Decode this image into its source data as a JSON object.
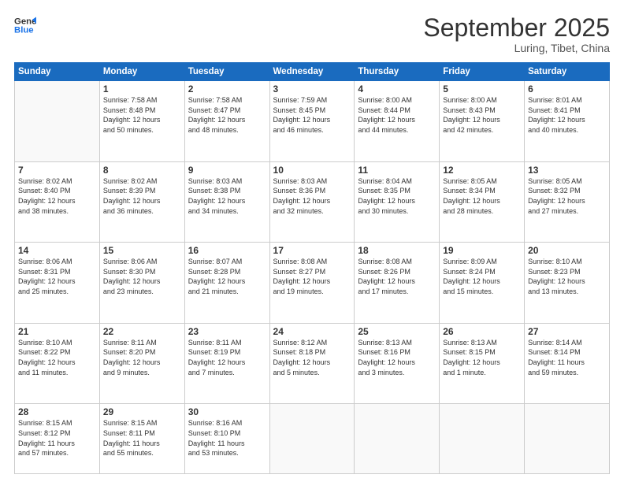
{
  "header": {
    "logo": {
      "line1": "General",
      "line2": "Blue"
    },
    "title": "September 2025",
    "location": "Luring, Tibet, China"
  },
  "weekdays": [
    "Sunday",
    "Monday",
    "Tuesday",
    "Wednesday",
    "Thursday",
    "Friday",
    "Saturday"
  ],
  "weeks": [
    [
      {
        "day": "",
        "text": ""
      },
      {
        "day": "1",
        "text": "Sunrise: 7:58 AM\nSunset: 8:48 PM\nDaylight: 12 hours\nand 50 minutes."
      },
      {
        "day": "2",
        "text": "Sunrise: 7:58 AM\nSunset: 8:47 PM\nDaylight: 12 hours\nand 48 minutes."
      },
      {
        "day": "3",
        "text": "Sunrise: 7:59 AM\nSunset: 8:45 PM\nDaylight: 12 hours\nand 46 minutes."
      },
      {
        "day": "4",
        "text": "Sunrise: 8:00 AM\nSunset: 8:44 PM\nDaylight: 12 hours\nand 44 minutes."
      },
      {
        "day": "5",
        "text": "Sunrise: 8:00 AM\nSunset: 8:43 PM\nDaylight: 12 hours\nand 42 minutes."
      },
      {
        "day": "6",
        "text": "Sunrise: 8:01 AM\nSunset: 8:41 PM\nDaylight: 12 hours\nand 40 minutes."
      }
    ],
    [
      {
        "day": "7",
        "text": "Sunrise: 8:02 AM\nSunset: 8:40 PM\nDaylight: 12 hours\nand 38 minutes."
      },
      {
        "day": "8",
        "text": "Sunrise: 8:02 AM\nSunset: 8:39 PM\nDaylight: 12 hours\nand 36 minutes."
      },
      {
        "day": "9",
        "text": "Sunrise: 8:03 AM\nSunset: 8:38 PM\nDaylight: 12 hours\nand 34 minutes."
      },
      {
        "day": "10",
        "text": "Sunrise: 8:03 AM\nSunset: 8:36 PM\nDaylight: 12 hours\nand 32 minutes."
      },
      {
        "day": "11",
        "text": "Sunrise: 8:04 AM\nSunset: 8:35 PM\nDaylight: 12 hours\nand 30 minutes."
      },
      {
        "day": "12",
        "text": "Sunrise: 8:05 AM\nSunset: 8:34 PM\nDaylight: 12 hours\nand 28 minutes."
      },
      {
        "day": "13",
        "text": "Sunrise: 8:05 AM\nSunset: 8:32 PM\nDaylight: 12 hours\nand 27 minutes."
      }
    ],
    [
      {
        "day": "14",
        "text": "Sunrise: 8:06 AM\nSunset: 8:31 PM\nDaylight: 12 hours\nand 25 minutes."
      },
      {
        "day": "15",
        "text": "Sunrise: 8:06 AM\nSunset: 8:30 PM\nDaylight: 12 hours\nand 23 minutes."
      },
      {
        "day": "16",
        "text": "Sunrise: 8:07 AM\nSunset: 8:28 PM\nDaylight: 12 hours\nand 21 minutes."
      },
      {
        "day": "17",
        "text": "Sunrise: 8:08 AM\nSunset: 8:27 PM\nDaylight: 12 hours\nand 19 minutes."
      },
      {
        "day": "18",
        "text": "Sunrise: 8:08 AM\nSunset: 8:26 PM\nDaylight: 12 hours\nand 17 minutes."
      },
      {
        "day": "19",
        "text": "Sunrise: 8:09 AM\nSunset: 8:24 PM\nDaylight: 12 hours\nand 15 minutes."
      },
      {
        "day": "20",
        "text": "Sunrise: 8:10 AM\nSunset: 8:23 PM\nDaylight: 12 hours\nand 13 minutes."
      }
    ],
    [
      {
        "day": "21",
        "text": "Sunrise: 8:10 AM\nSunset: 8:22 PM\nDaylight: 12 hours\nand 11 minutes."
      },
      {
        "day": "22",
        "text": "Sunrise: 8:11 AM\nSunset: 8:20 PM\nDaylight: 12 hours\nand 9 minutes."
      },
      {
        "day": "23",
        "text": "Sunrise: 8:11 AM\nSunset: 8:19 PM\nDaylight: 12 hours\nand 7 minutes."
      },
      {
        "day": "24",
        "text": "Sunrise: 8:12 AM\nSunset: 8:18 PM\nDaylight: 12 hours\nand 5 minutes."
      },
      {
        "day": "25",
        "text": "Sunrise: 8:13 AM\nSunset: 8:16 PM\nDaylight: 12 hours\nand 3 minutes."
      },
      {
        "day": "26",
        "text": "Sunrise: 8:13 AM\nSunset: 8:15 PM\nDaylight: 12 hours\nand 1 minute."
      },
      {
        "day": "27",
        "text": "Sunrise: 8:14 AM\nSunset: 8:14 PM\nDaylight: 11 hours\nand 59 minutes."
      }
    ],
    [
      {
        "day": "28",
        "text": "Sunrise: 8:15 AM\nSunset: 8:12 PM\nDaylight: 11 hours\nand 57 minutes."
      },
      {
        "day": "29",
        "text": "Sunrise: 8:15 AM\nSunset: 8:11 PM\nDaylight: 11 hours\nand 55 minutes."
      },
      {
        "day": "30",
        "text": "Sunrise: 8:16 AM\nSunset: 8:10 PM\nDaylight: 11 hours\nand 53 minutes."
      },
      {
        "day": "",
        "text": ""
      },
      {
        "day": "",
        "text": ""
      },
      {
        "day": "",
        "text": ""
      },
      {
        "day": "",
        "text": ""
      }
    ]
  ]
}
